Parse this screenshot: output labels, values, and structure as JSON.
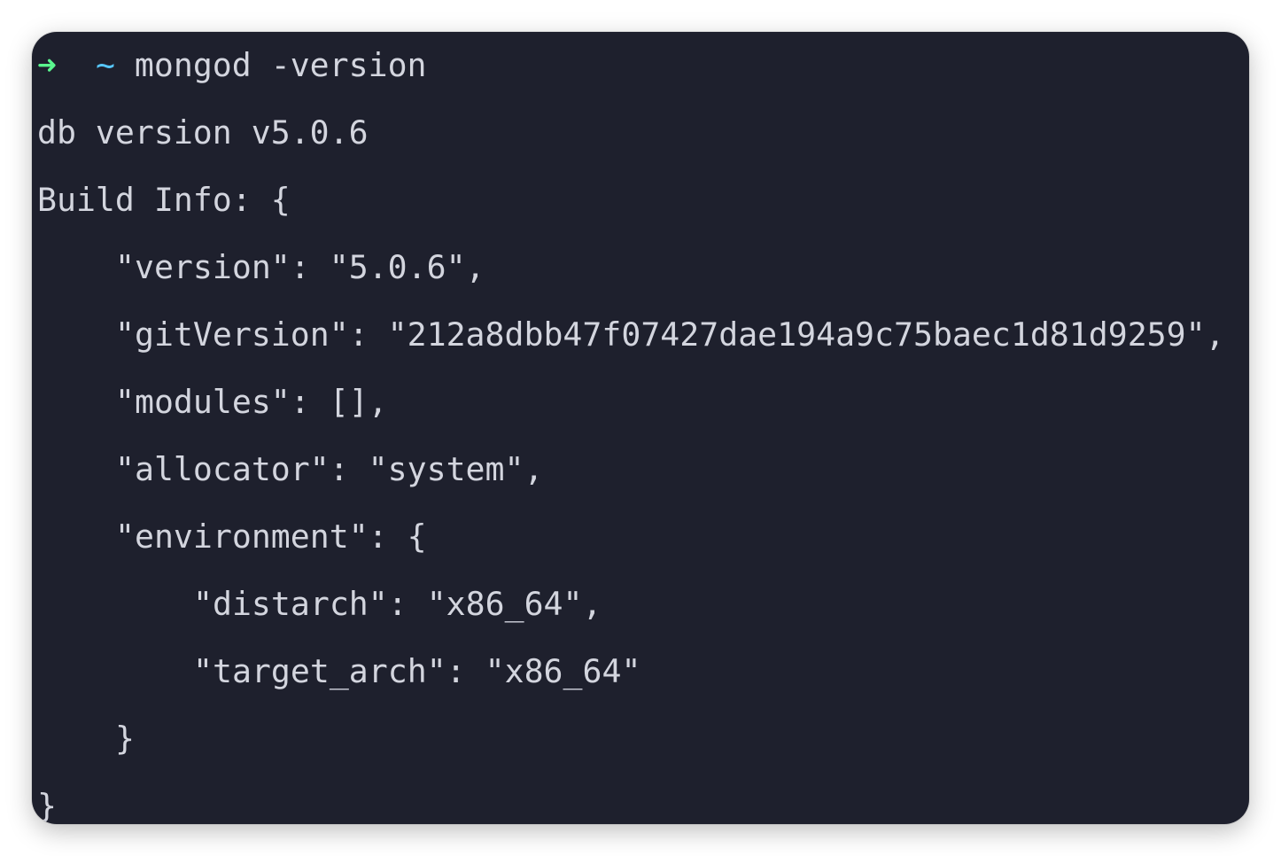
{
  "terminal": {
    "colors": {
      "background": "#1e202d",
      "foreground": "#d3d5de",
      "prompt_arrow": "#5af78e",
      "prompt_cwd": "#57c7ff"
    },
    "prompt": {
      "arrow_icon": "right-arrow-icon",
      "arrow": "➜",
      "cwd": "~",
      "command": "mongod -version"
    },
    "output": [
      "db version v5.0.6",
      "Build Info: {",
      "\"version\": \"5.0.6\",",
      "\"gitVersion\": \"212a8dbb47f07427dae194a9c75baec1d81d9259\",",
      "\"modules\": [],",
      "\"allocator\": \"system\",",
      "\"environment\": {",
      "\"distarch\": \"x86_64\",",
      "\"target_arch\": \"x86_64\"",
      "}",
      "}"
    ]
  }
}
